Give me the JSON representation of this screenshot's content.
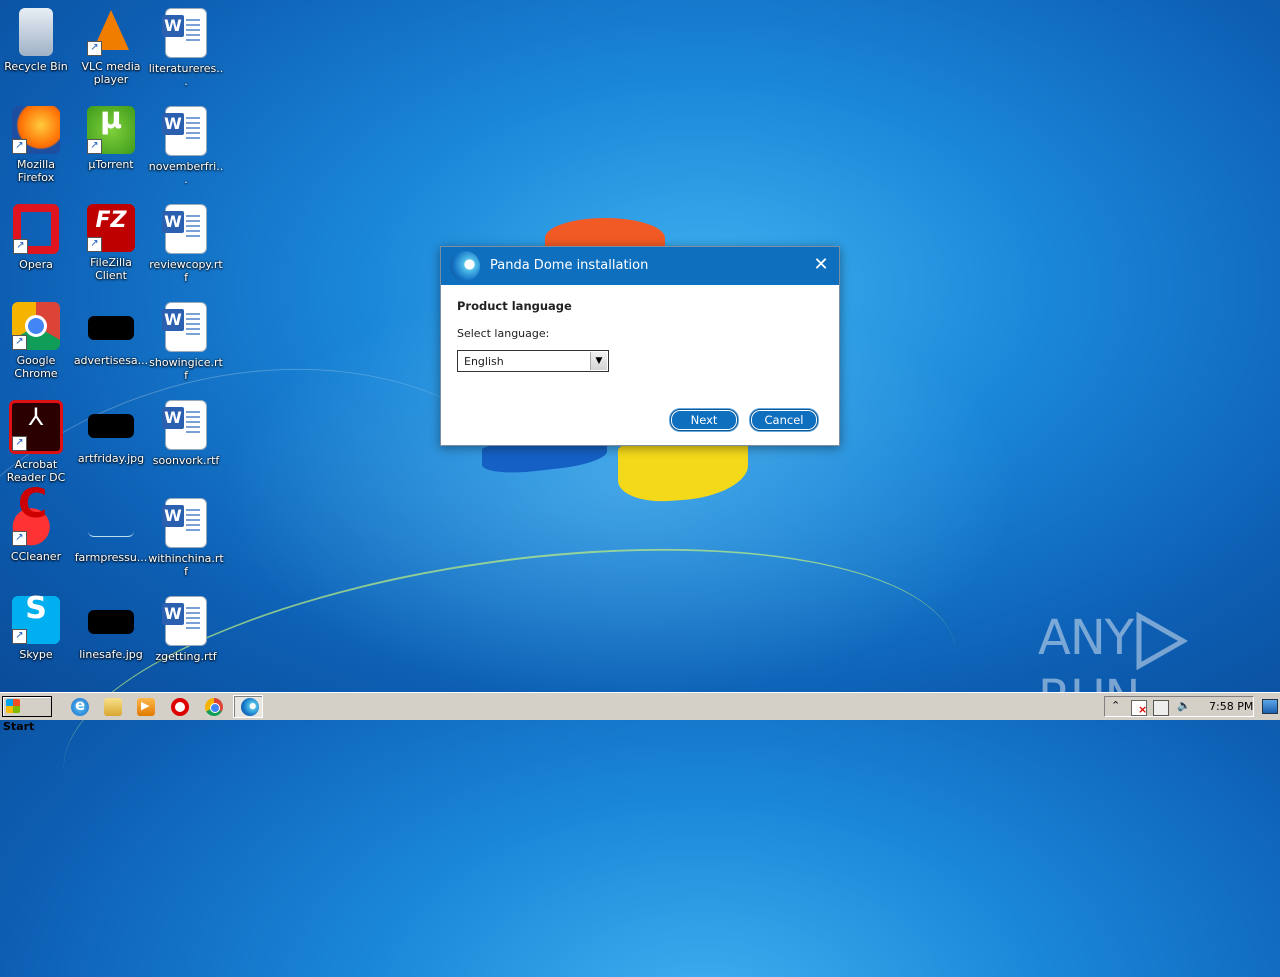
{
  "desktop": {
    "icons": [
      {
        "label": "Recycle Bin",
        "icon": "recycle-bin-icon"
      },
      {
        "label": "VLC media player",
        "icon": "vlc-icon"
      },
      {
        "label": "literatureres...",
        "icon": "word-document-icon"
      },
      {
        "label": "Mozilla Firefox",
        "icon": "firefox-icon"
      },
      {
        "label": "µTorrent",
        "icon": "utorrent-icon"
      },
      {
        "label": "novemberfri...",
        "icon": "word-document-icon"
      },
      {
        "label": "Opera",
        "icon": "opera-icon"
      },
      {
        "label": "FileZilla Client",
        "icon": "filezilla-icon"
      },
      {
        "label": "reviewcopy.rtf",
        "icon": "word-document-icon"
      },
      {
        "label": "Google Chrome",
        "icon": "chrome-icon"
      },
      {
        "label": "advertisesa...",
        "icon": "image-file-icon"
      },
      {
        "label": "showingice.rtf",
        "icon": "word-document-icon"
      },
      {
        "label": "Acrobat Reader DC",
        "icon": "acrobat-icon"
      },
      {
        "label": "artfriday.jpg",
        "icon": "image-file-icon"
      },
      {
        "label": "soonvork.rtf",
        "icon": "word-document-icon"
      },
      {
        "label": "CCleaner",
        "icon": "ccleaner-icon"
      },
      {
        "label": "farmpressu...",
        "icon": "image-file-icon"
      },
      {
        "label": "withinchina.rtf",
        "icon": "word-document-icon"
      },
      {
        "label": "Skype",
        "icon": "skype-icon"
      },
      {
        "label": "linesafe.jpg",
        "icon": "image-file-icon"
      },
      {
        "label": "zgetting.rtf",
        "icon": "word-document-icon"
      }
    ]
  },
  "dialog": {
    "title": "Panda Dome installation",
    "close_glyph": "✕",
    "heading": "Product language",
    "select_label": "Select language:",
    "selected_language": "English",
    "next_label": "Next",
    "cancel_label": "Cancel"
  },
  "watermark": {
    "left": "ANY",
    "right": "RUN"
  },
  "taskbar": {
    "start_label": "Start",
    "tray_up_glyph": "⌃",
    "clock": "7:58 PM"
  }
}
